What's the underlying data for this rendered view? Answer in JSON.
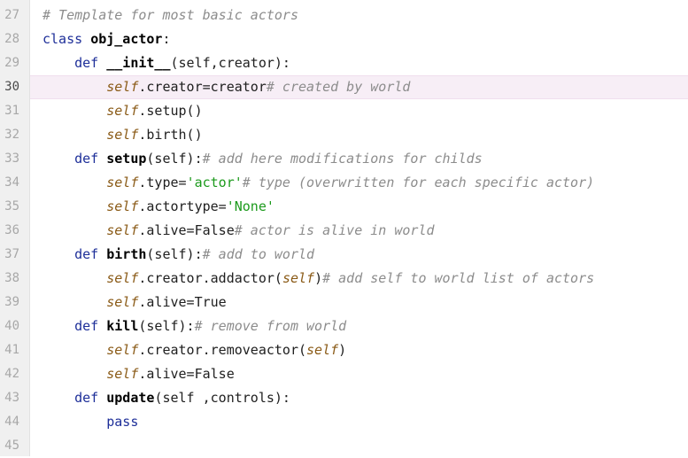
{
  "editor": {
    "language": "python",
    "current_line": "30",
    "colors": {
      "keyword": "#1e2f99",
      "self": "#8a5a16",
      "string": "#1c9a1c",
      "comment": "#8c8c8c",
      "current_line_bg": "#f7eef6"
    },
    "lines": [
      {
        "num": "27",
        "indent": "",
        "tokens": [
          {
            "t": "# Template for most basic actors",
            "c": "comment"
          }
        ]
      },
      {
        "num": "28",
        "indent": "",
        "tokens": [
          {
            "t": "class ",
            "c": "kw"
          },
          {
            "t": "obj_actor",
            "c": "fn"
          },
          {
            "t": ":",
            "c": ""
          }
        ]
      },
      {
        "num": "29",
        "indent": "    ",
        "tokens": [
          {
            "t": "def ",
            "c": "kw"
          },
          {
            "t": "__init__",
            "c": "fn"
          },
          {
            "t": "(self,creator):",
            "c": ""
          }
        ]
      },
      {
        "num": "30",
        "indent": "        ",
        "current": true,
        "tokens": [
          {
            "t": "self",
            "c": "self"
          },
          {
            "t": ".creator=creator",
            "c": ""
          },
          {
            "t": "# created by world",
            "c": "comment"
          }
        ]
      },
      {
        "num": "31",
        "indent": "        ",
        "tokens": [
          {
            "t": "self",
            "c": "self"
          },
          {
            "t": ".setup()",
            "c": ""
          }
        ]
      },
      {
        "num": "32",
        "indent": "        ",
        "tokens": [
          {
            "t": "self",
            "c": "self"
          },
          {
            "t": ".birth()",
            "c": ""
          }
        ]
      },
      {
        "num": "33",
        "indent": "    ",
        "tokens": [
          {
            "t": "def ",
            "c": "kw"
          },
          {
            "t": "setup",
            "c": "fn"
          },
          {
            "t": "(self):",
            "c": ""
          },
          {
            "t": "# add here modifications for childs",
            "c": "comment"
          }
        ]
      },
      {
        "num": "34",
        "indent": "        ",
        "tokens": [
          {
            "t": "self",
            "c": "self"
          },
          {
            "t": ".type=",
            "c": ""
          },
          {
            "t": "'actor'",
            "c": "str"
          },
          {
            "t": "# type (overwritten for each specific actor)",
            "c": "comment"
          }
        ]
      },
      {
        "num": "35",
        "indent": "        ",
        "tokens": [
          {
            "t": "self",
            "c": "self"
          },
          {
            "t": ".actortype=",
            "c": ""
          },
          {
            "t": "'None'",
            "c": "str"
          }
        ]
      },
      {
        "num": "36",
        "indent": "        ",
        "tokens": [
          {
            "t": "self",
            "c": "self"
          },
          {
            "t": ".alive=False",
            "c": ""
          },
          {
            "t": "# actor is alive in world",
            "c": "comment"
          }
        ]
      },
      {
        "num": "37",
        "indent": "    ",
        "tokens": [
          {
            "t": "def ",
            "c": "kw"
          },
          {
            "t": "birth",
            "c": "fn"
          },
          {
            "t": "(self):",
            "c": ""
          },
          {
            "t": "# add to world",
            "c": "comment"
          }
        ]
      },
      {
        "num": "38",
        "indent": "        ",
        "tokens": [
          {
            "t": "self",
            "c": "self"
          },
          {
            "t": ".creator.addactor(",
            "c": ""
          },
          {
            "t": "self",
            "c": "self"
          },
          {
            "t": ")",
            "c": ""
          },
          {
            "t": "# add self to world list of actors",
            "c": "comment"
          }
        ]
      },
      {
        "num": "39",
        "indent": "        ",
        "tokens": [
          {
            "t": "self",
            "c": "self"
          },
          {
            "t": ".alive=True",
            "c": ""
          }
        ]
      },
      {
        "num": "40",
        "indent": "    ",
        "tokens": [
          {
            "t": "def ",
            "c": "kw"
          },
          {
            "t": "kill",
            "c": "fn"
          },
          {
            "t": "(self):",
            "c": ""
          },
          {
            "t": "# remove from world",
            "c": "comment"
          }
        ]
      },
      {
        "num": "41",
        "indent": "        ",
        "tokens": [
          {
            "t": "self",
            "c": "self"
          },
          {
            "t": ".creator.removeactor(",
            "c": ""
          },
          {
            "t": "self",
            "c": "self"
          },
          {
            "t": ")",
            "c": ""
          }
        ]
      },
      {
        "num": "42",
        "indent": "        ",
        "tokens": [
          {
            "t": "self",
            "c": "self"
          },
          {
            "t": ".alive=False",
            "c": ""
          }
        ]
      },
      {
        "num": "43",
        "indent": "    ",
        "tokens": [
          {
            "t": "def ",
            "c": "kw"
          },
          {
            "t": "update",
            "c": "fn"
          },
          {
            "t": "(self ,controls):",
            "c": ""
          }
        ]
      },
      {
        "num": "44",
        "indent": "        ",
        "tokens": [
          {
            "t": "pass",
            "c": "kw"
          }
        ]
      },
      {
        "num": "45",
        "indent": "",
        "tokens": []
      }
    ]
  }
}
